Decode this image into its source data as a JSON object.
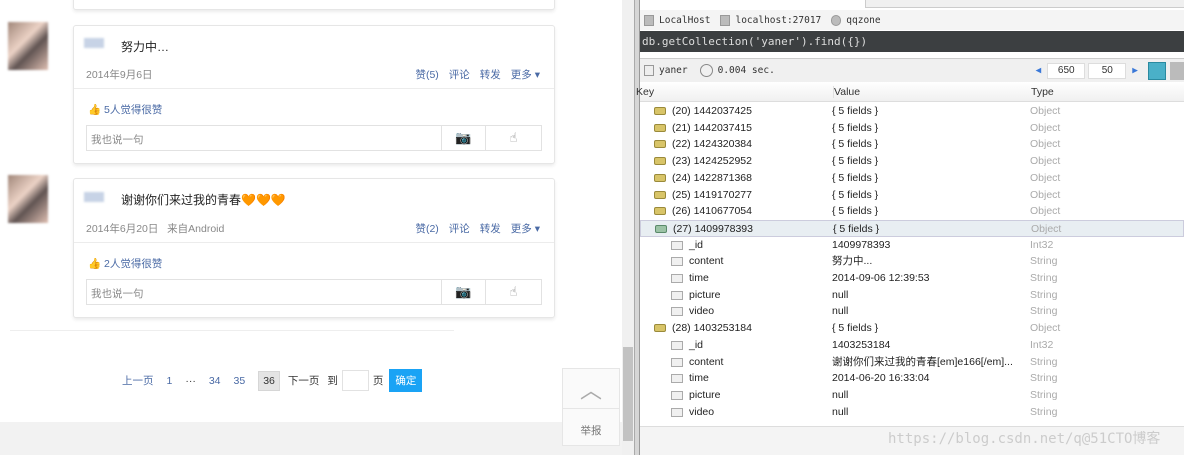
{
  "posts": [
    {
      "content": "努力中…",
      "date": "2014年9月6日",
      "source": "",
      "like_btn": "赞(5)",
      "comment": "评论",
      "forward": "转发",
      "more": "更多",
      "likes_text": "5人觉得很赞",
      "comment_placeholder": "我也说一句"
    },
    {
      "content": "谢谢你们来过我的青春",
      "emoji": "🧡🧡🧡",
      "date": "2014年6月20日",
      "source": "来自Android",
      "like_btn": "赞(2)",
      "comment": "评论",
      "forward": "转发",
      "more": "更多",
      "likes_text": "2人觉得很赞",
      "comment_placeholder": "我也说一句"
    }
  ],
  "pager": {
    "prev": "上一页",
    "first": "1",
    "ellipsis": "···",
    "p34": "34",
    "p35": "35",
    "current": "36",
    "next": "下一页",
    "goto": "到",
    "page": "页",
    "confirm": "确定"
  },
  "report": "举报",
  "robo": {
    "conn": {
      "host": "LocalHost",
      "server": "localhost:27017",
      "db": "qqzone"
    },
    "query": "db.getCollection('yaner').find({})",
    "collection": "yaner",
    "time": "0.004 sec.",
    "skip": "650",
    "limit": "50",
    "headers": {
      "key": "Key",
      "value": "Value",
      "type": "Type"
    },
    "rows": [
      {
        "key": "(20) 1442037425",
        "value": "{ 5 fields }",
        "type": "Object"
      },
      {
        "key": "(21) 1442037415",
        "value": "{ 5 fields }",
        "type": "Object"
      },
      {
        "key": "(22) 1424320384",
        "value": "{ 5 fields }",
        "type": "Object"
      },
      {
        "key": "(23) 1424252952",
        "value": "{ 5 fields }",
        "type": "Object"
      },
      {
        "key": "(24) 1422871368",
        "value": "{ 5 fields }",
        "type": "Object"
      },
      {
        "key": "(25) 1419170277",
        "value": "{ 5 fields }",
        "type": "Object"
      },
      {
        "key": "(26) 1410677054",
        "value": "{ 5 fields }",
        "type": "Object"
      },
      {
        "key": "(27) 1409978393",
        "value": "{ 5 fields }",
        "type": "Object",
        "selected": true
      },
      {
        "key": "_id",
        "value": "1409978393",
        "type": "Int32",
        "child": true
      },
      {
        "key": "content",
        "value": "努力中...",
        "type": "String",
        "child": true
      },
      {
        "key": "time",
        "value": "2014-09-06 12:39:53",
        "type": "String",
        "child": true
      },
      {
        "key": "picture",
        "value": "null",
        "type": "String",
        "child": true
      },
      {
        "key": "video",
        "value": "null",
        "type": "String",
        "child": true
      },
      {
        "key": "(28) 1403253184",
        "value": "{ 5 fields }",
        "type": "Object"
      },
      {
        "key": "_id",
        "value": "1403253184",
        "type": "Int32",
        "child": true
      },
      {
        "key": "content",
        "value": "谢谢你们来过我的青春[em]e166[/em]...",
        "type": "String",
        "child": true
      },
      {
        "key": "time",
        "value": "2014-06-20 16:33:04",
        "type": "String",
        "child": true
      },
      {
        "key": "picture",
        "value": "null",
        "type": "String",
        "child": true
      },
      {
        "key": "video",
        "value": "null",
        "type": "String",
        "child": true
      }
    ]
  },
  "watermark": "https://blog.csdn.net/q@51CTO博客"
}
